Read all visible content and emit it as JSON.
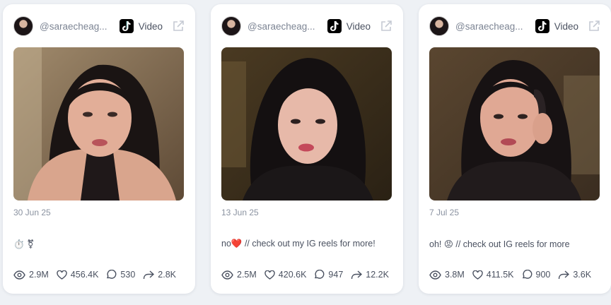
{
  "cards": [
    {
      "username": "@saraecheag...",
      "type_label": "Video",
      "date": "30 Jun 25",
      "caption": "⏱️ ⚧",
      "views": "2.9M",
      "likes": "456.4K",
      "comments": "530",
      "shares": "2.8K"
    },
    {
      "username": "@saraecheag...",
      "type_label": "Video",
      "date": "13 Jun 25",
      "caption": "no❤️ // check out my IG reels for more!",
      "views": "2.5M",
      "likes": "420.6K",
      "comments": "947",
      "shares": "12.2K"
    },
    {
      "username": "@saraecheag...",
      "type_label": "Video",
      "date": "7 Jul 25",
      "caption": "oh! 😡 // check out IG reels for more",
      "views": "3.8M",
      "likes": "411.5K",
      "comments": "900",
      "shares": "3.6K"
    }
  ],
  "icons": {
    "platform": "tiktok-icon",
    "external": "external-link-icon",
    "views": "eye-icon",
    "likes": "heart-icon",
    "comments": "comment-icon",
    "shares": "share-icon"
  },
  "colors": {
    "background": "#eef1f5",
    "card": "#ffffff",
    "text": "#4a5160",
    "muted": "#8a92a0"
  }
}
